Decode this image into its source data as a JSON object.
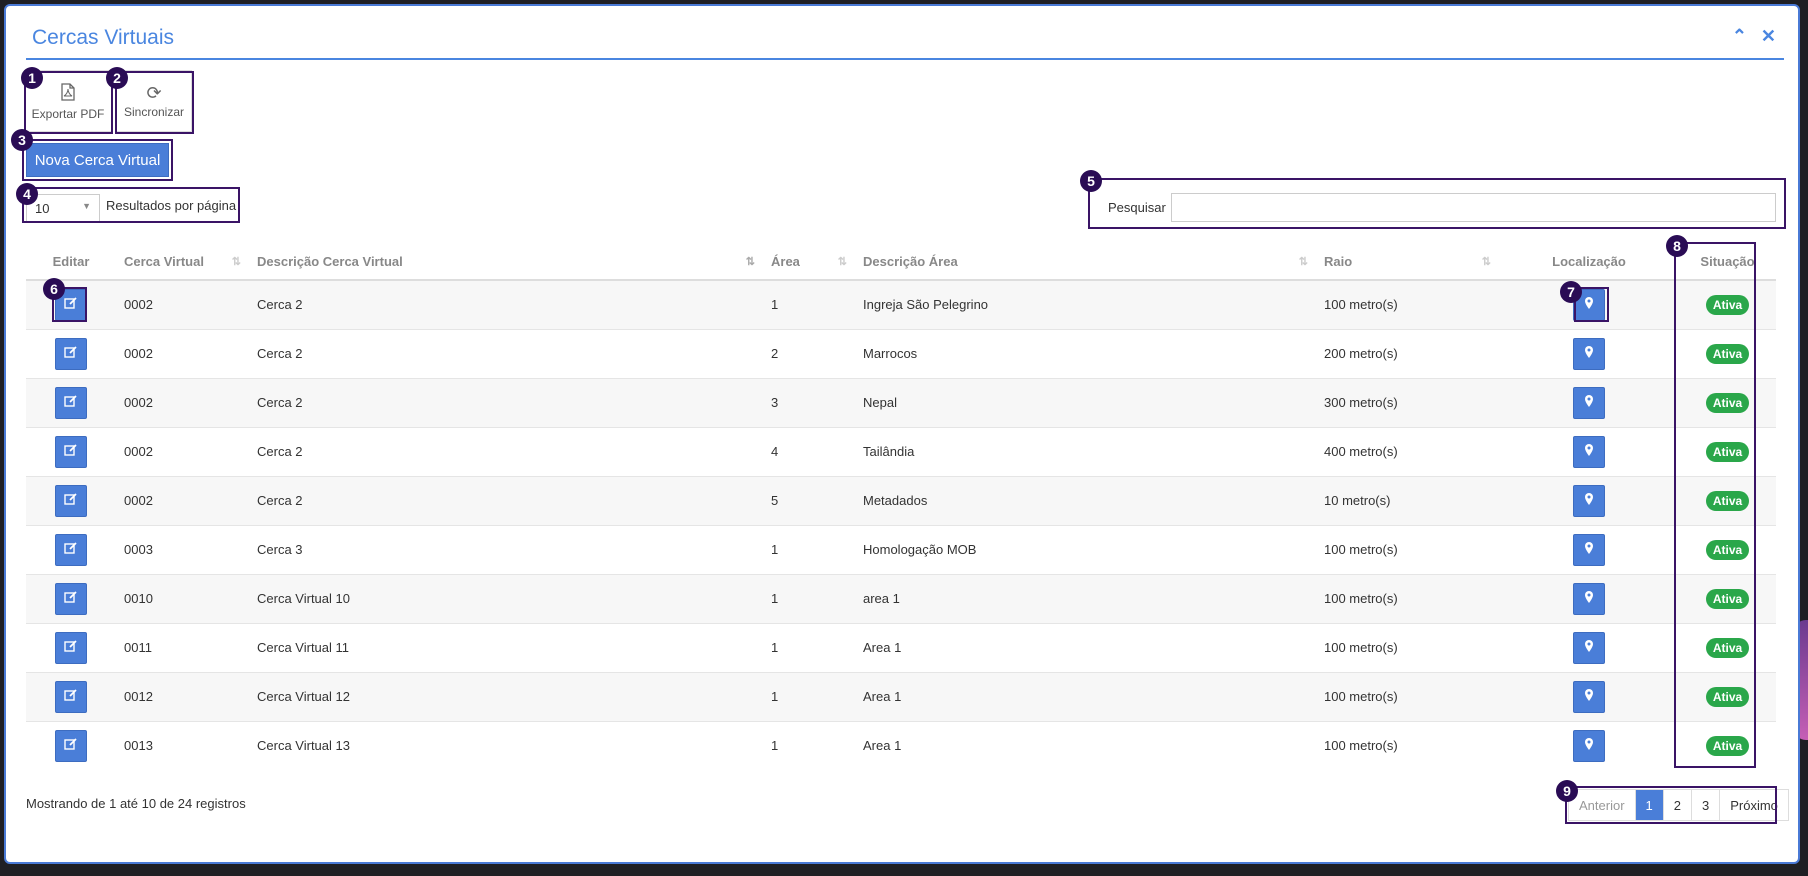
{
  "panel": {
    "title": "Cercas Virtuais",
    "collapse_icon": "chevron-up-icon",
    "close_icon": "close-icon"
  },
  "toolbar": {
    "export_label": "Exportar PDF",
    "export_icon": "pdf-file-icon",
    "sync_label": "Sincronizar",
    "sync_icon": "refresh-icon",
    "new_label": "Nova Cerca Virtual"
  },
  "page_size": {
    "value": "10",
    "label": "Resultados por página"
  },
  "search": {
    "label": "Pesquisar",
    "value": "",
    "placeholder": ""
  },
  "columns": [
    "Editar",
    "Cerca Virtual",
    "Descrição Cerca Virtual",
    "Área",
    "Descrição Área",
    "Raio",
    "Localização",
    "Situação"
  ],
  "rows": [
    {
      "code": "0002",
      "desc": "Cerca 2",
      "area": "1",
      "area_desc": "Ingreja São Pelegrino",
      "radius": "100 metro(s)",
      "status": "Ativa"
    },
    {
      "code": "0002",
      "desc": "Cerca 2",
      "area": "2",
      "area_desc": "Marrocos",
      "radius": "200 metro(s)",
      "status": "Ativa"
    },
    {
      "code": "0002",
      "desc": "Cerca 2",
      "area": "3",
      "area_desc": "Nepal",
      "radius": "300 metro(s)",
      "status": "Ativa"
    },
    {
      "code": "0002",
      "desc": "Cerca 2",
      "area": "4",
      "area_desc": "Tailândia",
      "radius": "400 metro(s)",
      "status": "Ativa"
    },
    {
      "code": "0002",
      "desc": "Cerca 2",
      "area": "5",
      "area_desc": "Metadados",
      "radius": "10 metro(s)",
      "status": "Ativa"
    },
    {
      "code": "0003",
      "desc": "Cerca 3",
      "area": "1",
      "area_desc": "Homologação MOB",
      "radius": "100 metro(s)",
      "status": "Ativa"
    },
    {
      "code": "0010",
      "desc": "Cerca Virtual 10",
      "area": "1",
      "area_desc": "area 1",
      "radius": "100 metro(s)",
      "status": "Ativa"
    },
    {
      "code": "0011",
      "desc": "Cerca Virtual 11",
      "area": "1",
      "area_desc": "Area 1",
      "radius": "100 metro(s)",
      "status": "Ativa"
    },
    {
      "code": "0012",
      "desc": "Cerca Virtual 12",
      "area": "1",
      "area_desc": "Area 1",
      "radius": "100 metro(s)",
      "status": "Ativa"
    },
    {
      "code": "0013",
      "desc": "Cerca Virtual 13",
      "area": "1",
      "area_desc": "Area 1",
      "radius": "100 metro(s)",
      "status": "Ativa"
    }
  ],
  "row_icons": {
    "edit": "edit-icon",
    "location": "map-pin-icon"
  },
  "footer": {
    "info": "Mostrando de 1 até 10 de 24 registros"
  },
  "pagination": {
    "prev": "Anterior",
    "pages": [
      "1",
      "2",
      "3"
    ],
    "active": "1",
    "next": "Próximo"
  },
  "annotations": [
    "1",
    "2",
    "3",
    "4",
    "5",
    "6",
    "7",
    "8",
    "9"
  ],
  "colors": {
    "accent": "#4a7ed8",
    "title": "#4a86e0",
    "status_ok": "#2aa74a",
    "annotation": "#2a0c55"
  }
}
